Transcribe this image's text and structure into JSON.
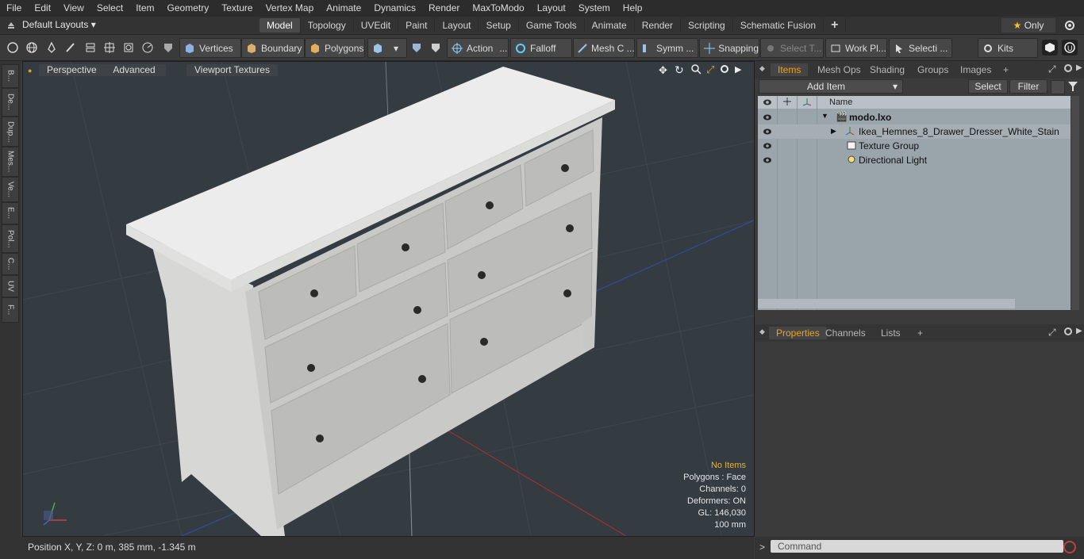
{
  "menu": [
    "File",
    "Edit",
    "View",
    "Select",
    "Item",
    "Geometry",
    "Texture",
    "Vertex Map",
    "Animate",
    "Dynamics",
    "Render",
    "MaxToModo",
    "Layout",
    "System",
    "Help"
  ],
  "layout": {
    "select_label": "Default Layouts ▾"
  },
  "tabs": [
    "Model",
    "Topology",
    "UVEdit",
    "Paint",
    "Layout",
    "Setup",
    "Game Tools",
    "Animate",
    "Render",
    "Scripting",
    "Schematic Fusion"
  ],
  "only_label": "Only",
  "toolbar": {
    "vertices": "Vertices",
    "boundary": "Boundary",
    "polygons": "Polygons",
    "action": "Action",
    "falloff": "Falloff",
    "mesh": "Mesh C ...",
    "symm": "Symm ...",
    "snapping": "Snapping",
    "select_t": "Select T...",
    "work_pl": "Work Pl...",
    "selecti": "Selecti ...",
    "kits": "Kits"
  },
  "left_strip": [
    "B...",
    "De...",
    "Dup...",
    "Mes...",
    "Ve...",
    "E...",
    "Pol...",
    "C...",
    "UV",
    "F..."
  ],
  "viewport": {
    "perspective": "Perspective",
    "advanced": "Advanced",
    "viewport_textures": "Viewport Textures",
    "info": {
      "no_items": "No Items",
      "polygons": "Polygons : Face",
      "channels": "Channels: 0",
      "deformers": "Deformers: ON",
      "gl": "GL: 146,030",
      "unit": "100 mm"
    }
  },
  "status": {
    "position": "Position X, Y, Z:   0 m, 385 mm, -1.345 m"
  },
  "items_panel": {
    "tabs": [
      "Items",
      "Mesh Ops",
      "Shading",
      "Groups",
      "Images"
    ],
    "add_item": "Add Item",
    "select": "Select",
    "filter": "Filter",
    "name_header": "Name",
    "rows": [
      {
        "label": "modo.lxo",
        "bold": true
      },
      {
        "label": "Ikea_Hemnes_8_Drawer_Dresser_White_Stain"
      },
      {
        "label": "Texture Group"
      },
      {
        "label": "Directional Light"
      }
    ]
  },
  "properties_panel": {
    "tabs": [
      "Properties",
      "Channels",
      "Lists"
    ]
  },
  "command": {
    "placeholder": "Command"
  }
}
